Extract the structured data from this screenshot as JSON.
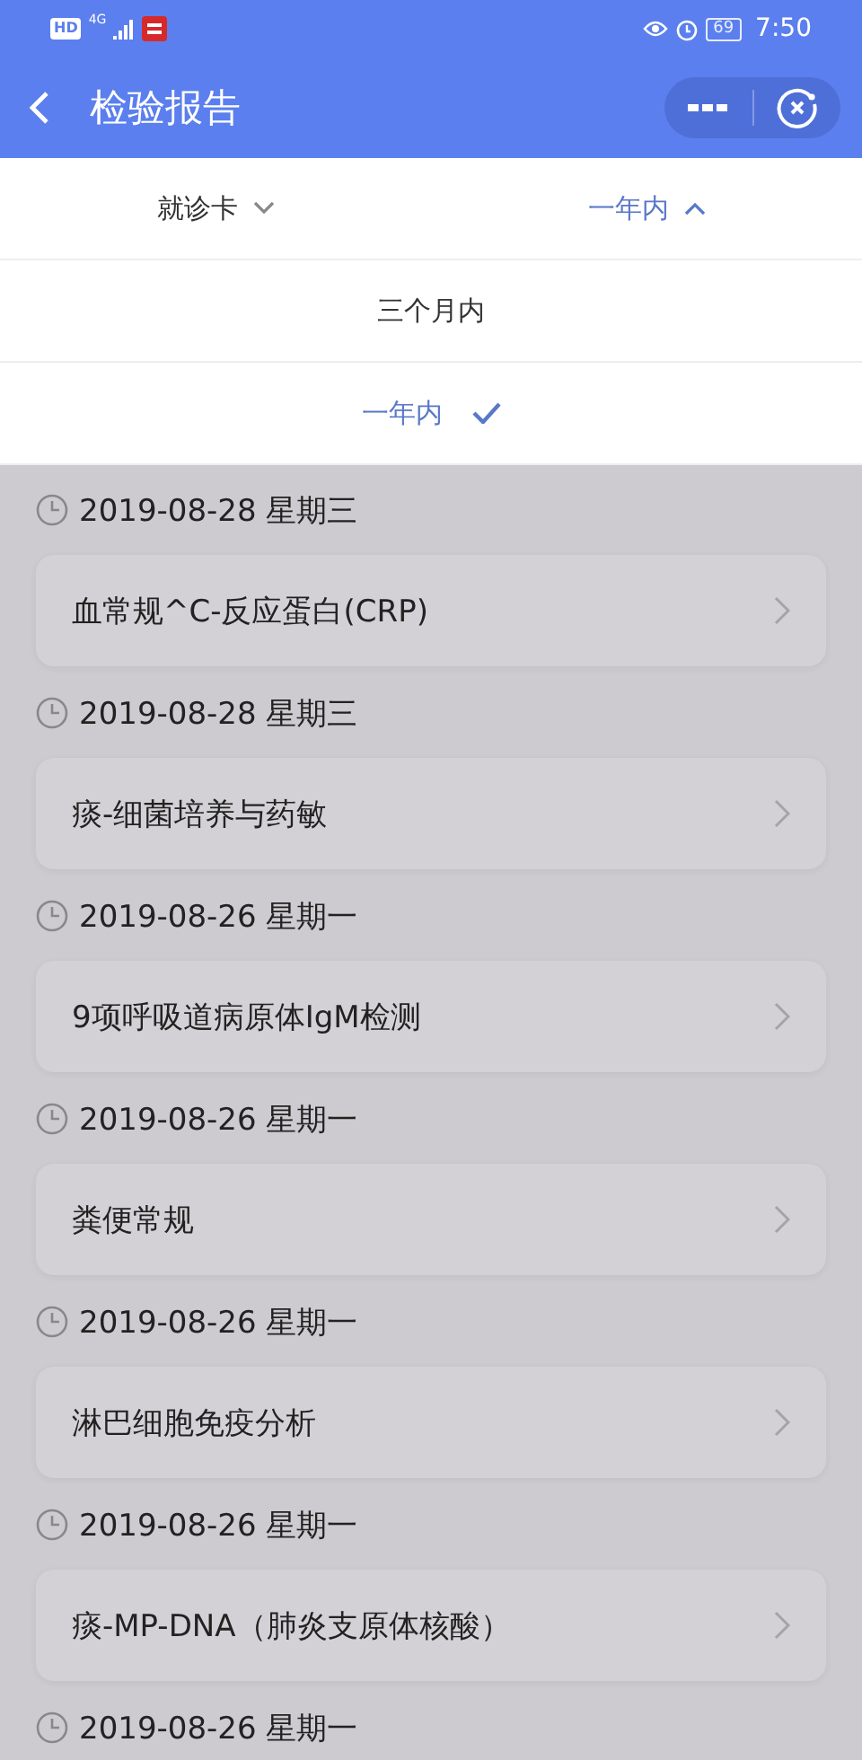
{
  "status_bar": {
    "hd": "HD",
    "network": "4G",
    "battery": "69",
    "time": "7:50"
  },
  "header": {
    "title": "检验报告"
  },
  "filters": [
    {
      "label": "就诊卡",
      "expanded": false
    },
    {
      "label": "一年内",
      "expanded": true
    }
  ],
  "dropdown_options": [
    {
      "label": "三个月内",
      "selected": false
    },
    {
      "label": "一年内",
      "selected": true
    }
  ],
  "reports": [
    {
      "date": "2019-08-28 星期三",
      "name": "血常规^C-反应蛋白(CRP)"
    },
    {
      "date": "2019-08-28 星期三",
      "name": "痰-细菌培养与药敏"
    },
    {
      "date": "2019-08-26 星期一",
      "name": "9项呼吸道病原体IgM检测"
    },
    {
      "date": "2019-08-26 星期一",
      "name": "粪便常规"
    },
    {
      "date": "2019-08-26 星期一",
      "name": "淋巴细胞免疫分析"
    },
    {
      "date": "2019-08-26 星期一",
      "name": "痰-MP-DNA（肺炎支原体核酸）"
    },
    {
      "date": "2019-08-26 星期一"
    }
  ]
}
